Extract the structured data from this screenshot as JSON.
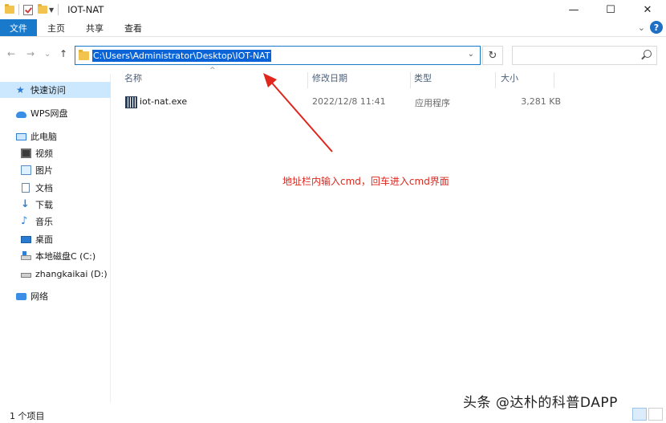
{
  "window": {
    "title": "IOT-NAT",
    "minimize_glyph": "—",
    "maximize_glyph": "☐",
    "close_glyph": "✕"
  },
  "ribbon": {
    "tabs": [
      "文件",
      "主页",
      "共享",
      "查看"
    ],
    "expand_glyph": "⌄",
    "help_glyph": "?"
  },
  "navigation": {
    "back_glyph": "←",
    "forward_glyph": "→",
    "recent_glyph": "⌄",
    "up_glyph": "↑",
    "address_path": "C:\\Users\\Administrator\\Desktop\\IOT-NAT",
    "address_drop_glyph": "⌄",
    "refresh_glyph": "↻",
    "search_placeholder": ""
  },
  "sidebar": {
    "items": [
      {
        "label": "快速访问",
        "icon": "star-icon"
      },
      {
        "label": "WPS网盘",
        "icon": "cloud-icon"
      },
      {
        "label": "此电脑",
        "icon": "computer-icon"
      },
      {
        "label": "视频",
        "icon": "video-icon"
      },
      {
        "label": "图片",
        "icon": "pictures-icon"
      },
      {
        "label": "文档",
        "icon": "documents-icon"
      },
      {
        "label": "下载",
        "icon": "download-icon"
      },
      {
        "label": "音乐",
        "icon": "music-icon"
      },
      {
        "label": "桌面",
        "icon": "desktop-icon"
      },
      {
        "label": "本地磁盘C (C:)",
        "icon": "drive-c-icon"
      },
      {
        "label": "zhangkaikai (D:)",
        "icon": "drive-d-icon"
      },
      {
        "label": "网络",
        "icon": "network-icon"
      }
    ]
  },
  "file_list": {
    "columns": [
      "名称",
      "修改日期",
      "类型",
      "大小"
    ],
    "sort_glyph": "^",
    "rows": [
      {
        "name": "iot-nat.exe",
        "modified": "2022/12/8 11:41",
        "type": "应用程序",
        "size": "3,281 KB",
        "icon": "exe-icon"
      }
    ]
  },
  "annotation": {
    "text": "地址栏内输入cmd，回车进入cmd界面",
    "color": "#e0261d"
  },
  "status": {
    "item_count": "1 个项目"
  },
  "watermark": "头条 @达朴的科普DAPP",
  "colors": {
    "accent": "#1979ca",
    "selection": "#0a64d8",
    "sidebar_active": "#cce8ff"
  }
}
